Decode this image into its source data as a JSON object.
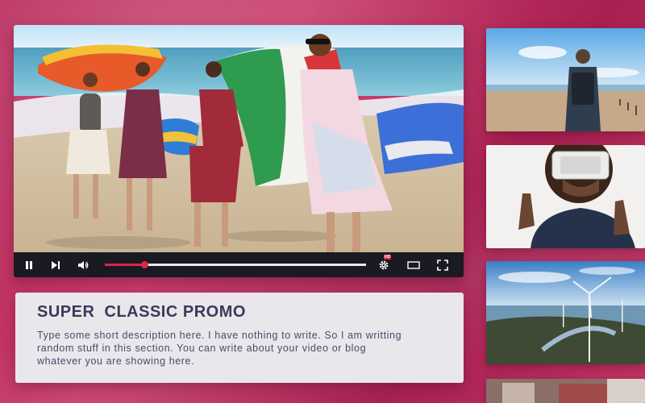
{
  "card": {
    "title": "SUPER  CLASSIC PROMO",
    "description": "Type some short description here. I have nothing to write. So I am writting random stuff in this section. You can write about your video or blog whatever you are showing  here."
  },
  "player": {
    "progress_fraction": 0.15,
    "hd_label": "HD"
  },
  "colors": {
    "accent": "#e0244a",
    "controls_bg": "#1a1a22",
    "background": "#b8285a"
  }
}
